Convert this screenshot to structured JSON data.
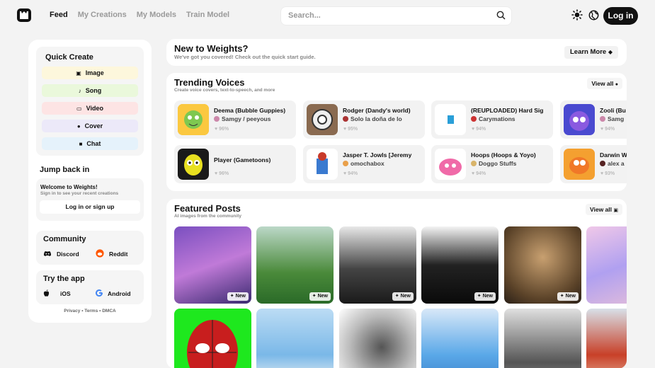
{
  "nav": {
    "items": [
      "Feed",
      "My Creations",
      "My Models",
      "Train Model"
    ]
  },
  "search": {
    "placeholder": "Search..."
  },
  "header": {
    "login": "Log in"
  },
  "quick_create": {
    "title": "Quick Create",
    "items": [
      {
        "label": "Image",
        "icon": "image-icon",
        "color": "#fdf7dc"
      },
      {
        "label": "Song",
        "icon": "music-icon",
        "color": "#eaf8db"
      },
      {
        "label": "Video",
        "icon": "video-icon",
        "color": "#fde4e4"
      },
      {
        "label": "Cover",
        "icon": "user-icon",
        "color": "#ece9f9"
      },
      {
        "label": "Chat",
        "icon": "chat-icon",
        "color": "#e5f2fb"
      }
    ]
  },
  "jump_back": {
    "title": "Jump back in",
    "welcome_title": "Welcome to Weights!",
    "welcome_sub": "Sign in to see your recent creations",
    "cta": "Log in or sign up"
  },
  "community": {
    "title": "Community",
    "discord": "Discord",
    "reddit": "Reddit"
  },
  "app": {
    "title": "Try the app",
    "ios": "iOS",
    "android": "Android"
  },
  "footer": {
    "privacy": "Privacy",
    "terms": "Terms",
    "dmca": "DMCA",
    "sep": "•"
  },
  "banner": {
    "title": "New to Weights?",
    "subtitle": "We've got you covered! Check out the quick start guide.",
    "cta": "Learn More"
  },
  "trending": {
    "title": "Trending Voices",
    "subtitle": "Create voice covers, text-to-speech, and more",
    "view_all": "View all",
    "voices": [
      {
        "name": "Deema (Bubble Guppies)",
        "author": "Samgy / peeyous",
        "rating": "96%"
      },
      {
        "name": "Rodger (Dandy's world)",
        "author": "Solo la doña de lo",
        "rating": "95%"
      },
      {
        "name": "(REUPLOADED) Hard Sig",
        "author": "Carymations",
        "rating": "94%"
      },
      {
        "name": "Zooli (Bu",
        "author": "Samg",
        "rating": "94%"
      },
      {
        "name": "Player (Gametoons)",
        "author": "",
        "rating": "96%"
      },
      {
        "name": "Jasper T. Jowls [Jeremy",
        "author": "omochabox",
        "rating": "94%"
      },
      {
        "name": "Hoops (Hoops & Yoyo)",
        "author": "Doggo Stuffs",
        "rating": "94%"
      },
      {
        "name": "Darwin W",
        "author": "alex a",
        "rating": "93%"
      }
    ]
  },
  "featured": {
    "title": "Featured Posts",
    "subtitle": "AI images from the community",
    "view_all": "View all",
    "badge": "New"
  }
}
